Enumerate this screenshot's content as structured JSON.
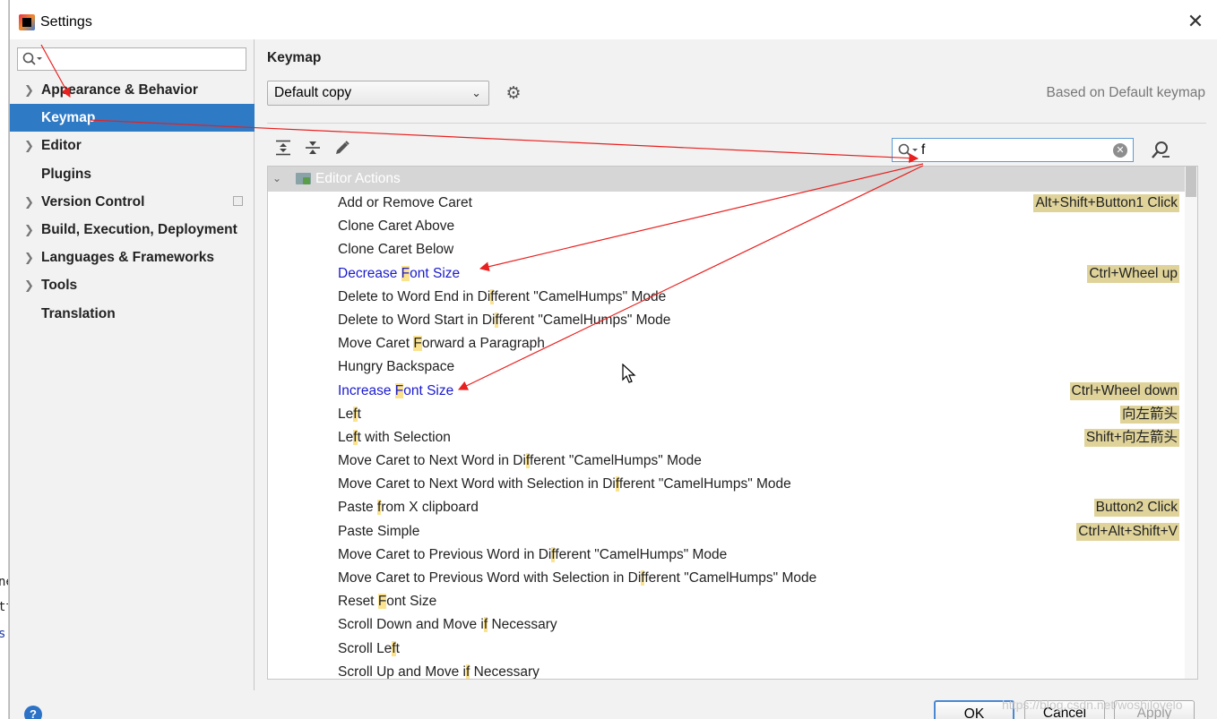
{
  "window": {
    "title": "Settings",
    "close_glyph": "✕"
  },
  "bg_strip": [
    "ne",
    "tt",
    "s:"
  ],
  "left": {
    "search_placeholder": "",
    "tree": [
      {
        "label": "Appearance & Behavior",
        "expandable": true
      },
      {
        "label": "Keymap",
        "expandable": false,
        "selected": true
      },
      {
        "label": "Editor",
        "expandable": true
      },
      {
        "label": "Plugins",
        "expandable": false
      },
      {
        "label": "Version Control",
        "expandable": true,
        "copy_icon": true
      },
      {
        "label": "Build, Execution, Deployment",
        "expandable": true
      },
      {
        "label": "Languages & Frameworks",
        "expandable": true
      },
      {
        "label": "Tools",
        "expandable": true
      },
      {
        "label": "Translation",
        "expandable": false
      }
    ]
  },
  "right": {
    "section_title": "Keymap",
    "keymap_select": "Default copy",
    "based_on": "Based on Default keymap",
    "search_value": "f",
    "group_label": "Editor Actions"
  },
  "actions": [
    {
      "name": "Add or Remove Caret",
      "shortcut": "Alt+Shift+Button1 Click"
    },
    {
      "name": "Clone Caret Above",
      "shortcut": ""
    },
    {
      "name": "Clone Caret Below",
      "shortcut": ""
    },
    {
      "name": "Decrease Font Size",
      "shortcut": "Ctrl+Wheel up",
      "modified": true
    },
    {
      "name": "Delete to Word End in Different \"CamelHumps\" Mode",
      "shortcut": ""
    },
    {
      "name": "Delete to Word Start in Different \"CamelHumps\" Mode",
      "shortcut": ""
    },
    {
      "name": "Move Caret Forward a Paragraph",
      "shortcut": ""
    },
    {
      "name": "Hungry Backspace",
      "shortcut": ""
    },
    {
      "name": "Increase Font Size",
      "shortcut": "Ctrl+Wheel down",
      "modified": true
    },
    {
      "name": "Left",
      "shortcut": "向左箭头"
    },
    {
      "name": "Left with Selection",
      "shortcut": "Shift+向左箭头"
    },
    {
      "name": "Move Caret to Next Word in Different \"CamelHumps\" Mode",
      "shortcut": ""
    },
    {
      "name": "Move Caret to Next Word with Selection in Different \"CamelHumps\" Mode",
      "shortcut": ""
    },
    {
      "name": "Paste from X clipboard",
      "shortcut": "Button2 Click"
    },
    {
      "name": "Paste Simple",
      "shortcut": "Ctrl+Alt+Shift+V"
    },
    {
      "name": "Move Caret to Previous Word in Different \"CamelHumps\" Mode",
      "shortcut": ""
    },
    {
      "name": "Move Caret to Previous Word with Selection in Different \"CamelHumps\" Mode",
      "shortcut": ""
    },
    {
      "name": "Reset Font Size",
      "shortcut": ""
    },
    {
      "name": "Scroll Down and Move if Necessary",
      "shortcut": ""
    },
    {
      "name": "Scroll Left",
      "shortcut": ""
    },
    {
      "name": "Scroll Up and Move if Necessary",
      "shortcut": ""
    }
  ],
  "buttons": {
    "ok": "OK",
    "cancel": "Cancel",
    "apply": "Apply",
    "help": "?"
  },
  "watermark": "https://blog.csdn.net/woshilovelo",
  "colors": {
    "selection": "#2f7ac5",
    "modified_text": "#1a1acd",
    "highlight": "#fbe28f",
    "shortcut_bg": "#dfd39a",
    "annotation": "#e8201f"
  },
  "icons": [
    "app-icon",
    "close-icon",
    "search-icon",
    "gear-icon",
    "expand-all-icon",
    "collapse-all-icon",
    "edit-icon",
    "clear-icon",
    "find-shortcut-icon",
    "folder-icon",
    "chevron-right-icon",
    "chevron-down-icon",
    "help-icon",
    "cursor-icon"
  ]
}
